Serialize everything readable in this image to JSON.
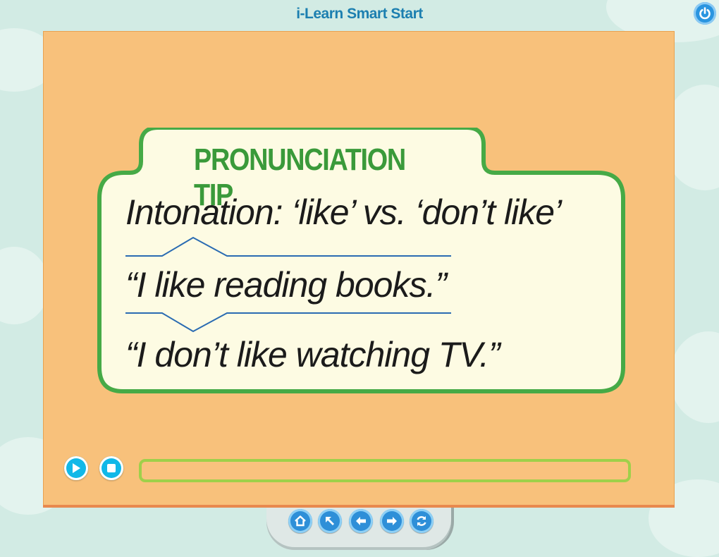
{
  "app": {
    "title": "i-Learn Smart Start"
  },
  "tip": {
    "heading": "PRONUNCIATION TIP",
    "lines": [
      "Intonation: ‘like’ vs. ‘don’t like’",
      "“I like reading books.”",
      "“I don’t like watching TV.”"
    ]
  },
  "player": {
    "progress": 0
  },
  "nav": {
    "buttons": [
      "home-icon",
      "arrow-up-left-icon",
      "arrow-left-icon",
      "arrow-right-icon",
      "refresh-icon"
    ]
  },
  "colors": {
    "stage": "#f8c17b",
    "card": "#fdfbe3",
    "card_border": "#46aa46",
    "heading": "#3a9a3a",
    "intonation": "#2a6bb2",
    "player_button": "#11b8e8",
    "progress_border": "#9fd04a",
    "nav_button": "#2e8fd8"
  }
}
